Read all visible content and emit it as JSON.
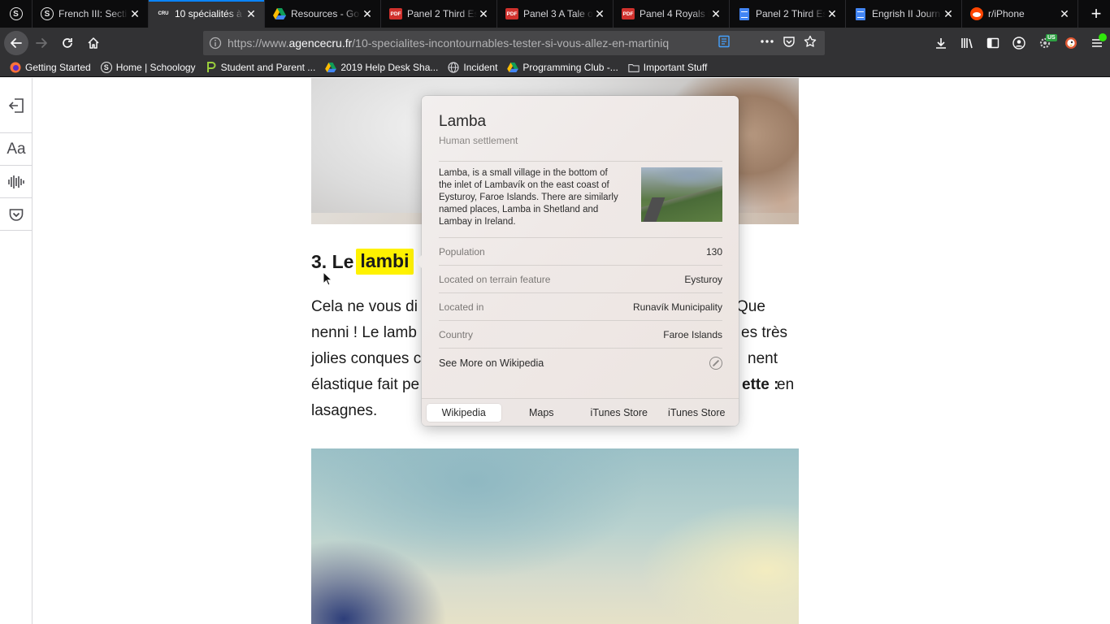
{
  "tabs": {
    "pinned": {
      "icon": "schoology-icon"
    },
    "items": [
      {
        "title": "French III: Secti",
        "icon": "schoology-icon",
        "active": false
      },
      {
        "title": "10 spécialités à",
        "icon": "cru-icon",
        "active": true
      },
      {
        "title": "Resources - Go",
        "icon": "google-drive-icon",
        "active": false
      },
      {
        "title": "Panel 2 Third Es",
        "icon": "pdf-icon",
        "active": false
      },
      {
        "title": "Panel 3 A Tale o",
        "icon": "pdf-icon",
        "active": false
      },
      {
        "title": "Panel 4 Royals I",
        "icon": "pdf-icon",
        "active": false
      },
      {
        "title": "Panel 2 Third Es",
        "icon": "google-docs-icon",
        "active": false
      },
      {
        "title": "Engrish II Journ",
        "icon": "google-docs-icon",
        "active": false
      },
      {
        "title": "r/iPhone",
        "icon": "reddit-icon",
        "active": false
      }
    ],
    "cru_favicon_text": "CRU",
    "pdf_favicon_text": "PDF",
    "schoology_favicon_text": "S",
    "close_glyph": "✕",
    "new_tab_glyph": "+"
  },
  "navbar": {
    "url_prefix": "https://www.",
    "url_host": "agencecru.fr",
    "url_path": "/10-specialites-incontournables-tester-si-vous-allez-en-martiniq",
    "addon_badge": "US"
  },
  "bookmarks": [
    {
      "label": "Getting Started",
      "icon": "firefox-icon"
    },
    {
      "label": "Home | Schoology",
      "icon": "schoology-icon"
    },
    {
      "label": "Student and Parent ...",
      "icon": "p-logo-icon"
    },
    {
      "label": "2019 Help Desk Sha...",
      "icon": "google-drive-icon"
    },
    {
      "label": "Incident",
      "icon": "globe-icon"
    },
    {
      "label": "Programming Club -...",
      "icon": "google-drive-icon"
    },
    {
      "label": "Important Stuff",
      "icon": "folder-icon"
    }
  ],
  "reader": {
    "type_controls_label": "Aa"
  },
  "article": {
    "heading_prefix": "3. Le",
    "heading_highlight": "lambi",
    "lines": [
      {
        "left": "Cela ne vous di",
        "right": "Que"
      },
      {
        "left": "nenni ! Le lamb",
        "right": "es très"
      },
      {
        "left": "jolies conques c",
        "right": "nent"
      },
      {
        "left": "élastique fait pe",
        "right_bold": "ette :",
        "right": " en"
      },
      {
        "left": "lasagnes.",
        "right": ""
      }
    ]
  },
  "lookup": {
    "title": "Lamba",
    "subtitle": "Human settlement",
    "description": "Lamba, is a small village in the bottom of the inlet of Lambavík on the east coast of Eysturoy, Faroe Islands. There are similarly named places, Lamba in Shetland and Lambay in Ireland.",
    "facts": [
      {
        "key": "Population",
        "value": "130"
      },
      {
        "key": "Located on terrain feature",
        "value": "Eysturoy"
      },
      {
        "key": "Located in",
        "value": "Runavík Municipality"
      },
      {
        "key": "Country",
        "value": "Faroe Islands"
      }
    ],
    "more_link": "See More on Wikipedia",
    "tabs": [
      {
        "label": "Wikipedia",
        "selected": true
      },
      {
        "label": "Maps",
        "selected": false
      },
      {
        "label": "iTunes Store",
        "selected": false
      },
      {
        "label": "iTunes Store",
        "selected": false
      }
    ]
  },
  "colors": {
    "highlight": "#fff200",
    "tab_accent": "#0a84ff",
    "chrome_dark": "#0c0c0d",
    "toolbar": "#323234"
  }
}
